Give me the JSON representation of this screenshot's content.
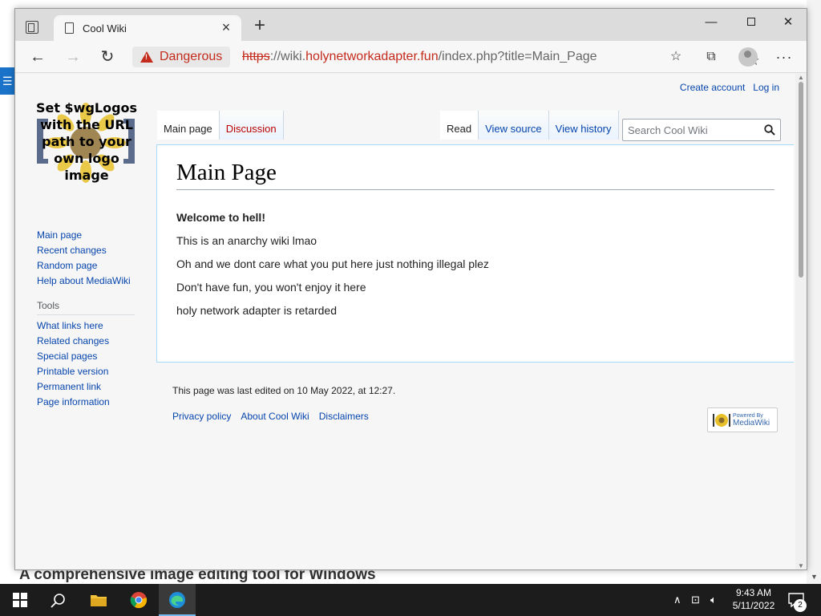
{
  "browser": {
    "tab_title": "Cool Wiki",
    "security_label": "Dangerous",
    "url_scheme": "https",
    "url_sep": "://",
    "url_host_prefix": "wiki.",
    "url_host": "holynetworkadapter.fun",
    "url_path": "/index.php?title=Main_Page"
  },
  "wiki": {
    "personal": {
      "create_account": "Create account",
      "login": "Log in"
    },
    "logo_text": "Set $wgLogos with the URL path to your own logo image",
    "tabs_left": [
      {
        "label": "Main page",
        "selected": true,
        "red": false
      },
      {
        "label": "Discussion",
        "selected": false,
        "red": true
      }
    ],
    "tabs_right": [
      {
        "label": "Read",
        "selected": true
      },
      {
        "label": "View source",
        "selected": false
      },
      {
        "label": "View history",
        "selected": false
      }
    ],
    "search_placeholder": "Search Cool Wiki",
    "navigation": [
      "Main page",
      "Recent changes",
      "Random page",
      "Help about MediaWiki"
    ],
    "tools_heading": "Tools",
    "tools": [
      "What links here",
      "Related changes",
      "Special pages",
      "Printable version",
      "Permanent link",
      "Page information"
    ],
    "page_title": "Main Page",
    "body": [
      "Welcome to hell!",
      "This is an anarchy wiki lmao",
      "Oh and we dont care what you put here just nothing illegal plez",
      "Don't have fun, you won't enjoy it here",
      "holy network adapter is retarded"
    ],
    "last_edited": "This page was last edited on 10 May 2022, at 12:27.",
    "footer_links": [
      "Privacy policy",
      "About Cool Wiki",
      "Disclaimers"
    ],
    "powered_by_small": "Powered By",
    "powered_by_brand": "MediaWiki"
  },
  "desktop": {
    "bottom_text": "A comprehensive image editing tool for Windows"
  },
  "taskbar": {
    "time": "9:43 AM",
    "date": "5/11/2022",
    "notification_count": "2"
  },
  "colors": {
    "danger": "#c42b1c",
    "link": "#0645ad",
    "redlink": "#ba0000",
    "taskbar": "#1c1c1c"
  }
}
